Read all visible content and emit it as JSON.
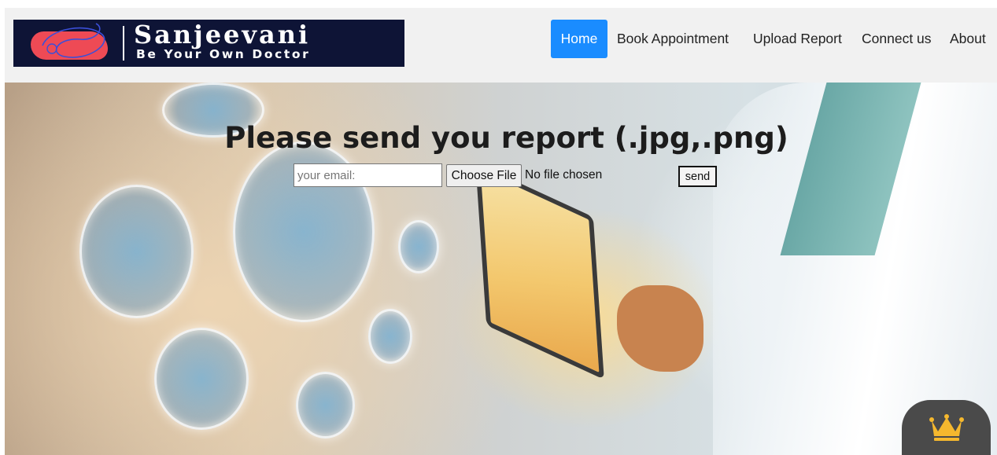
{
  "logo": {
    "brand": "Sanjeevani",
    "tagline": "Be Your Own Doctor"
  },
  "nav": {
    "items": [
      {
        "label": "Home",
        "active": true
      },
      {
        "label": "Book Appointment"
      },
      {
        "label": "Upload Report"
      },
      {
        "label": "Connect us"
      },
      {
        "label": "About"
      }
    ],
    "active_color": "#1a8cff"
  },
  "upload_form": {
    "title": "Please send you report (.jpg,.png)",
    "email_placeholder": "your email:",
    "choose_file_label": "Choose File",
    "no_file_text": "No file chosen",
    "send_label": "send"
  },
  "widget": {
    "icon": "crown-icon",
    "color": "#f5b82e"
  }
}
